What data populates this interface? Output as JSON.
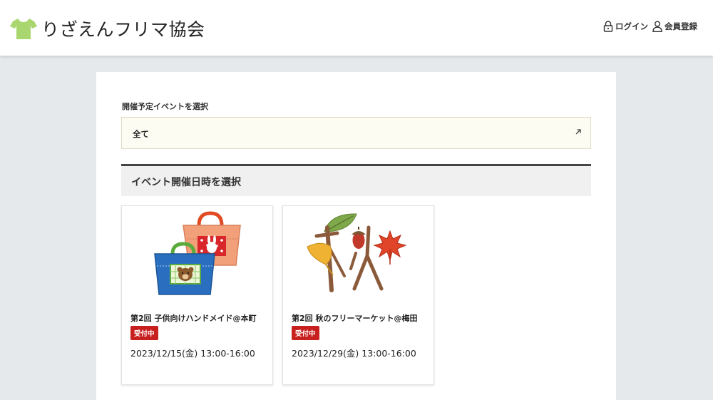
{
  "header": {
    "logo_text": "りざえんフリマ協会",
    "login_label": "ログイン",
    "register_label": "会員登録"
  },
  "event_select": {
    "label": "開催予定イベントを選択",
    "value": "全て"
  },
  "date_section": {
    "heading": "イベント開催日時を選択"
  },
  "events": [
    {
      "title": "第2回 子供向けハンドメイド@本町",
      "status": "受付中",
      "datetime": "2023/12/15(金)  13:00-16:00",
      "image": "tote-bags-illustration"
    },
    {
      "title": "第2回 秋のフリーマーケット@梅田",
      "status": "受付中",
      "datetime": "2023/12/29(金)  13:00-16:00",
      "image": "autumn-kanji-illustration"
    }
  ],
  "colors": {
    "page_bg": "#e6e9ec",
    "logo_green": "#a9d66f",
    "badge_red": "#c8201e",
    "select_bg": "#fcfcf3"
  }
}
